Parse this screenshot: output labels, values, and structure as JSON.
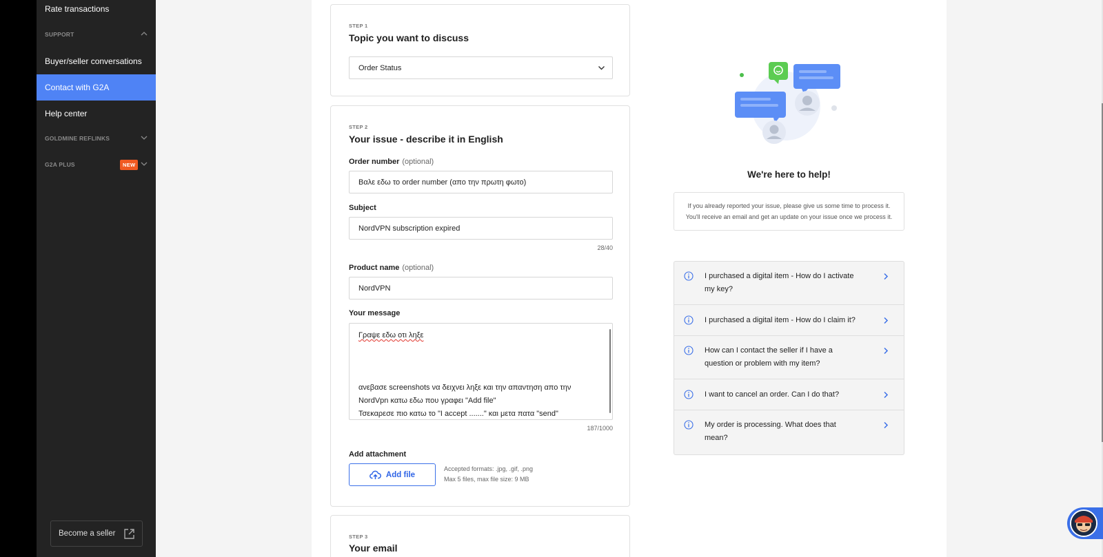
{
  "sidebar": {
    "items": [
      {
        "label": "Rate transactions"
      },
      {
        "label": "Buyer/seller conversations"
      },
      {
        "label": "Contact with G2A"
      },
      {
        "label": "Help center"
      }
    ],
    "sections": {
      "support": "SUPPORT",
      "goldmine": "GOLDMINE REFLINKS",
      "g2a_plus": "G2A PLUS",
      "new_badge": "NEW"
    },
    "become_seller": "Become a seller",
    "active_color": "#4f83f5"
  },
  "step1": {
    "label": "STEP 1",
    "title": "Topic you want to discuss",
    "topic_value": "Order Status"
  },
  "step2": {
    "label": "STEP 2",
    "title": "Your issue - describe it in English",
    "order_number": {
      "label": "Order number",
      "optional": "(optional)",
      "value": "Βαλε εδω το order number (απο την πρωτη φωτο)"
    },
    "subject": {
      "label": "Subject",
      "value": "NordVPN subscription expired",
      "counter": "28/40"
    },
    "product_name": {
      "label": "Product name",
      "optional": "(optional)",
      "value": "NordVPN"
    },
    "message": {
      "label": "Your message",
      "counter": "187/1000",
      "lines": [
        "Γραψε εδω οτι ληξε",
        "ανεβασε screenshots να δειχνει ληξε και την απαντηση απο την",
        "NordVpn κατω εδω που γραφει  \"Add file\"",
        "Τσεκαρεσε πιο κατω το \"I accept .......\" και μετα πατα \"send\""
      ]
    },
    "attachment": {
      "label": "Add attachment",
      "button": "Add file",
      "formats": "Accepted formats: .jpg, .gif, .png",
      "limits": "Max 5 files, max file size: 9 MB"
    }
  },
  "step3": {
    "label": "STEP 3",
    "title": "Your email"
  },
  "help": {
    "title": "We're here to help!",
    "note_line1": "If you already reported your issue, please give us some time to process it.",
    "note_line2": "You'll receive an email and get an update on your issue once we process it.",
    "faq": [
      {
        "line1": "I purchased a digital item - How do I activate",
        "line2": "my key?"
      },
      {
        "line1": "I purchased a digital item - How do I claim it?",
        "line2": ""
      },
      {
        "line1": "How can I contact the seller if I have a",
        "line2": "question or problem with my item?"
      },
      {
        "line1": "I want to cancel an order. Can I do that?",
        "line2": ""
      },
      {
        "line1": "My order is processing. What does that",
        "line2": "mean?"
      }
    ]
  },
  "colors": {
    "accent": "#3a6fe8",
    "badge": "#f05a22",
    "sidebar_bg": "#232323"
  }
}
